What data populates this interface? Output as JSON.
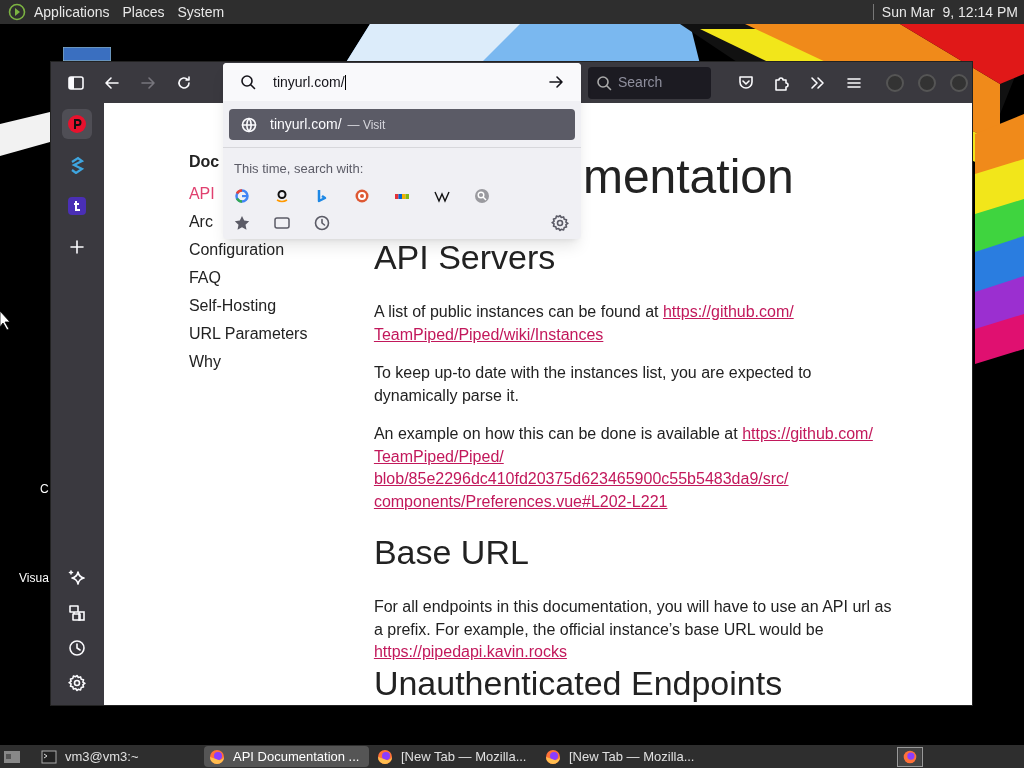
{
  "top_panel": {
    "menus": [
      "Applications",
      "Places",
      "System"
    ],
    "clock": "Sun Mar  9, 12:14 PM"
  },
  "desktop": {
    "icon_labels": [
      "C",
      "Visua"
    ]
  },
  "browser": {
    "toolbar": {
      "forward_disabled": true,
      "search_placeholder": "Search"
    },
    "sidebar": {
      "top": [
        {
          "kind": "piped",
          "selected": true
        },
        {
          "kind": "stack",
          "selected": false
        },
        {
          "kind": "tumblr",
          "selected": false
        },
        {
          "kind": "add",
          "selected": false
        }
      ],
      "bottom": [
        {
          "kind": "sparkle"
        },
        {
          "kind": "devices"
        },
        {
          "kind": "history"
        },
        {
          "kind": "settings"
        }
      ]
    },
    "url_popup": {
      "value": "tinyurl.com/",
      "result": {
        "text": "tinyurl.com/",
        "action": "— Visit",
        "selected": true
      },
      "search_with_label": "This time, search with:",
      "engines": [
        {
          "kind": "google"
        },
        {
          "kind": "amazon"
        },
        {
          "kind": "bing"
        },
        {
          "kind": "duckduckgo"
        },
        {
          "kind": "ebay"
        },
        {
          "kind": "wikipedia"
        },
        {
          "kind": "search"
        }
      ],
      "modes": [
        {
          "kind": "bookmarks"
        },
        {
          "kind": "tabs"
        },
        {
          "kind": "history"
        }
      ]
    },
    "page": {
      "nav_title": "Doc",
      "nav": [
        {
          "label": "API",
          "selected": true
        },
        {
          "label": "Arc",
          "selected": false
        },
        {
          "label": "Configuration",
          "selected": false
        },
        {
          "label": "FAQ",
          "selected": false
        },
        {
          "label": "Self-Hosting",
          "selected": false
        },
        {
          "label": "URL Parameters",
          "selected": false
        },
        {
          "label": "Why",
          "selected": false
        }
      ],
      "title": "mentation",
      "sections": [
        {
          "kind": "heading",
          "text": "API Servers"
        },
        {
          "kind": "paragraph",
          "text": "A list of public instances can be found at",
          "links": [
            "https://github.com/",
            "TeamPiped/Piped/wiki/Instances"
          ]
        },
        {
          "kind": "paragraph",
          "text": "To keep up-to date with the instances list, you are expected to dynamically parse it."
        },
        {
          "kind": "paragraph",
          "text": "An example on how this can be done is available at",
          "links": [
            "https://github.com/",
            "TeamPiped/Piped/",
            "blob/85e2296dc410fd20375d623465900c55b5483da9/src/",
            "components/Preferences.vue#L202-L221"
          ]
        },
        {
          "kind": "heading",
          "text": "Base URL"
        },
        {
          "kind": "paragraph",
          "text": "For all endpoints in this documentation, you will have to use an API url as a prefix. For example, the official instance’s base URL would be",
          "links": [
            "https://pipedapi.kavin.rocks"
          ]
        },
        {
          "kind": "heading",
          "text": "Unauthenticated Endpoints"
        }
      ]
    }
  },
  "taskbar": {
    "items": [
      {
        "kind": "terminal",
        "label": "vm3@vm3:~",
        "selected": false
      },
      {
        "kind": "firefox",
        "label": "API Documentation ...",
        "selected": true
      },
      {
        "kind": "firefox",
        "label": "[New Tab — Mozilla...",
        "selected": false
      },
      {
        "kind": "firefox",
        "label": "[New Tab — Mozilla...",
        "selected": false
      }
    ]
  }
}
